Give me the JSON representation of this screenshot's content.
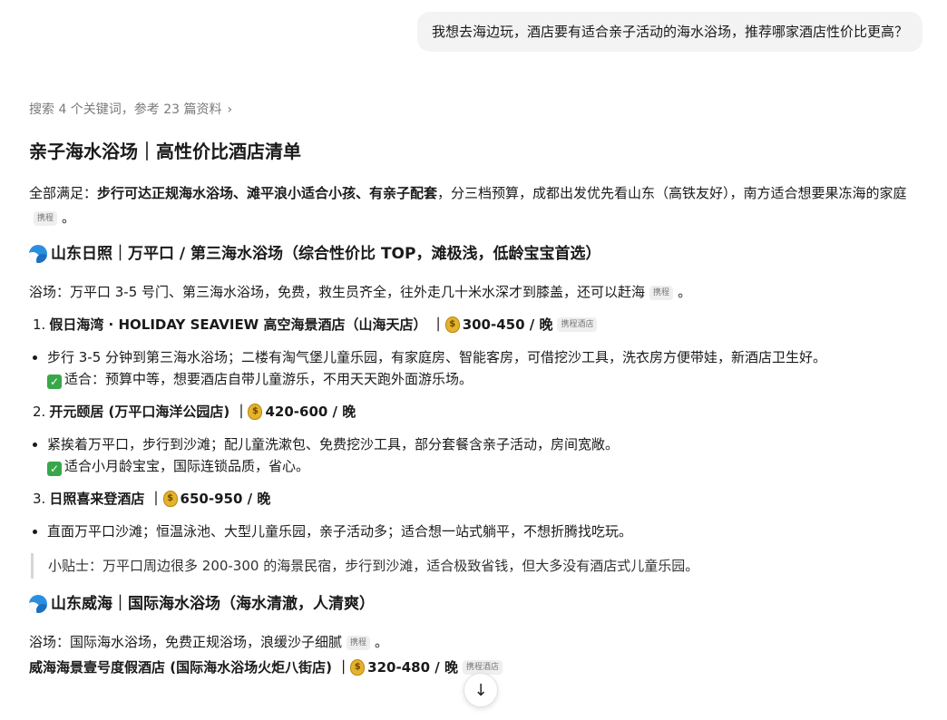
{
  "user_message": "我想去海边玩，酒店要有适合亲子活动的海水浴场，推荐哪家酒店性价比更高？",
  "search_summary": "搜索 4 个关键词，参考 23 篇资料",
  "title": "亲子海水浴场｜高性价比酒店清单",
  "intro": {
    "prefix": "全部满足：",
    "bold": "步行可达正规海水浴场、滩平浪小适合小孩、有亲子配套",
    "suffix": "，分三档预算，成都出发优先看山东（高铁友好），南方适合想要果冻海的家庭",
    "cite": "携程",
    "end": "。"
  },
  "section1": {
    "heading": "山东日照｜万平口 / 第三海水浴场（综合性价比 TOP，滩极浅，低龄宝宝首选）",
    "beach_text": "浴场：万平口 3-5 号门、第三海水浴场，免费，救生员齐全，往外走几十米水深才到膝盖，还可以赶海",
    "beach_cite": "携程",
    "beach_end": "。",
    "hotels": [
      {
        "num": "1.",
        "name": "假日海湾 · HOLIDAY SEAVIEW 高空海景酒店（山海天店） ｜",
        "price": "300-450 / 晚",
        "cite": "携程酒店",
        "bullet1": "步行 3-5 分钟到第三海水浴场；二楼有淘气堡儿童乐园，有家庭房、智能客房，可借挖沙工具，洗衣房方便带娃，新酒店卫生好。",
        "bullet2": "适合：预算中等，想要酒店自带儿童游乐，不用天天跑外面游乐场。"
      },
      {
        "num": "2.",
        "name": "开元颐居 (万平口海洋公园店) ｜",
        "price": "420-600 / 晚",
        "bullet1": "紧挨着万平口，步行到沙滩；配儿童洗漱包、免费挖沙工具，部分套餐含亲子活动，房间宽敞。",
        "bullet2": "适合小月龄宝宝，国际连锁品质，省心。"
      },
      {
        "num": "3.",
        "name": "日照喜来登酒店 ｜",
        "price": "650-950 / 晚",
        "bullet1": "直面万平口沙滩；恒温泳池、大型儿童乐园，亲子活动多；适合想一站式躺平，不想折腾找吃玩。"
      }
    ],
    "tip": "小贴士：万平口周边很多 200-300 的海景民宿，步行到沙滩，适合极致省钱，但大多没有酒店式儿童乐园。"
  },
  "section2": {
    "heading": "山东威海｜国际海水浴场（海水清澈，人清爽）",
    "beach_text": "浴场：国际海水浴场，免费正规浴场，浪缓沙子细腻",
    "beach_cite": "携程",
    "beach_end": "。",
    "hotel_name": "威海海景壹号度假酒店 (国际海水浴场火炬八街店) ｜",
    "hotel_price": "320-480 / 晚",
    "hotel_cite": "携程酒店"
  },
  "icons": {
    "wave": "water-wave-icon",
    "coin": "money-bag-icon",
    "check": "check-mark-icon",
    "scroll": "arrow-down-icon"
  }
}
